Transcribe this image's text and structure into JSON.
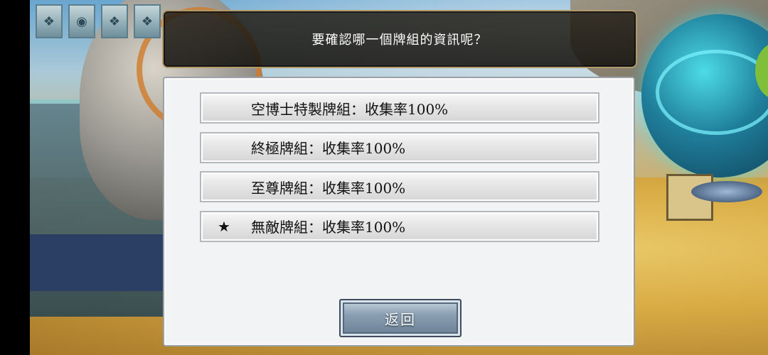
{
  "dialog": {
    "question": "要確認哪一個牌組的資訊呢？",
    "back_label": "返回"
  },
  "decks": [
    {
      "mark": "",
      "label": "空博士特製牌組：收集率100%"
    },
    {
      "mark": "",
      "label": "終極牌組：收集率100%"
    },
    {
      "mark": "",
      "label": "至尊牌組：收集率100%"
    },
    {
      "mark": "★",
      "label": "無敵牌組：收集率100%"
    }
  ],
  "background_emblems": [
    "ornament-icon",
    "eye-emblem-icon",
    "ornament-icon",
    "ornament-icon"
  ]
}
